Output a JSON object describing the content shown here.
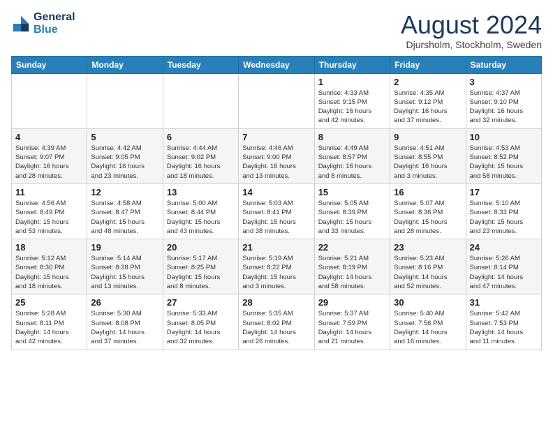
{
  "header": {
    "logo_line1": "General",
    "logo_line2": "Blue",
    "month": "August 2024",
    "location": "Djursholm, Stockholm, Sweden"
  },
  "weekdays": [
    "Sunday",
    "Monday",
    "Tuesday",
    "Wednesday",
    "Thursday",
    "Friday",
    "Saturday"
  ],
  "weeks": [
    [
      {
        "day": "",
        "content": ""
      },
      {
        "day": "",
        "content": ""
      },
      {
        "day": "",
        "content": ""
      },
      {
        "day": "",
        "content": ""
      },
      {
        "day": "1",
        "content": "Sunrise: 4:33 AM\nSunset: 9:15 PM\nDaylight: 16 hours\nand 42 minutes."
      },
      {
        "day": "2",
        "content": "Sunrise: 4:35 AM\nSunset: 9:12 PM\nDaylight: 16 hours\nand 37 minutes."
      },
      {
        "day": "3",
        "content": "Sunrise: 4:37 AM\nSunset: 9:10 PM\nDaylight: 16 hours\nand 32 minutes."
      }
    ],
    [
      {
        "day": "4",
        "content": "Sunrise: 4:39 AM\nSunset: 9:07 PM\nDaylight: 16 hours\nand 28 minutes."
      },
      {
        "day": "5",
        "content": "Sunrise: 4:42 AM\nSunset: 9:05 PM\nDaylight: 16 hours\nand 23 minutes."
      },
      {
        "day": "6",
        "content": "Sunrise: 4:44 AM\nSunset: 9:02 PM\nDaylight: 16 hours\nand 18 minutes."
      },
      {
        "day": "7",
        "content": "Sunrise: 4:46 AM\nSunset: 9:00 PM\nDaylight: 16 hours\nand 13 minutes."
      },
      {
        "day": "8",
        "content": "Sunrise: 4:49 AM\nSunset: 8:57 PM\nDaylight: 16 hours\nand 8 minutes."
      },
      {
        "day": "9",
        "content": "Sunrise: 4:51 AM\nSunset: 8:55 PM\nDaylight: 16 hours\nand 3 minutes."
      },
      {
        "day": "10",
        "content": "Sunrise: 4:53 AM\nSunset: 8:52 PM\nDaylight: 15 hours\nand 58 minutes."
      }
    ],
    [
      {
        "day": "11",
        "content": "Sunrise: 4:56 AM\nSunset: 8:49 PM\nDaylight: 15 hours\nand 53 minutes."
      },
      {
        "day": "12",
        "content": "Sunrise: 4:58 AM\nSunset: 8:47 PM\nDaylight: 15 hours\nand 48 minutes."
      },
      {
        "day": "13",
        "content": "Sunrise: 5:00 AM\nSunset: 8:44 PM\nDaylight: 15 hours\nand 43 minutes."
      },
      {
        "day": "14",
        "content": "Sunrise: 5:03 AM\nSunset: 8:41 PM\nDaylight: 15 hours\nand 38 minutes."
      },
      {
        "day": "15",
        "content": "Sunrise: 5:05 AM\nSunset: 8:39 PM\nDaylight: 15 hours\nand 33 minutes."
      },
      {
        "day": "16",
        "content": "Sunrise: 5:07 AM\nSunset: 8:36 PM\nDaylight: 15 hours\nand 28 minutes."
      },
      {
        "day": "17",
        "content": "Sunrise: 5:10 AM\nSunset: 8:33 PM\nDaylight: 15 hours\nand 23 minutes."
      }
    ],
    [
      {
        "day": "18",
        "content": "Sunrise: 5:12 AM\nSunset: 8:30 PM\nDaylight: 15 hours\nand 18 minutes."
      },
      {
        "day": "19",
        "content": "Sunrise: 5:14 AM\nSunset: 8:28 PM\nDaylight: 15 hours\nand 13 minutes."
      },
      {
        "day": "20",
        "content": "Sunrise: 5:17 AM\nSunset: 8:25 PM\nDaylight: 15 hours\nand 8 minutes."
      },
      {
        "day": "21",
        "content": "Sunrise: 5:19 AM\nSunset: 8:22 PM\nDaylight: 15 hours\nand 3 minutes."
      },
      {
        "day": "22",
        "content": "Sunrise: 5:21 AM\nSunset: 8:19 PM\nDaylight: 14 hours\nand 58 minutes."
      },
      {
        "day": "23",
        "content": "Sunrise: 5:23 AM\nSunset: 8:16 PM\nDaylight: 14 hours\nand 52 minutes."
      },
      {
        "day": "24",
        "content": "Sunrise: 5:26 AM\nSunset: 8:14 PM\nDaylight: 14 hours\nand 47 minutes."
      }
    ],
    [
      {
        "day": "25",
        "content": "Sunrise: 5:28 AM\nSunset: 8:11 PM\nDaylight: 14 hours\nand 42 minutes."
      },
      {
        "day": "26",
        "content": "Sunrise: 5:30 AM\nSunset: 8:08 PM\nDaylight: 14 hours\nand 37 minutes."
      },
      {
        "day": "27",
        "content": "Sunrise: 5:33 AM\nSunset: 8:05 PM\nDaylight: 14 hours\nand 32 minutes."
      },
      {
        "day": "28",
        "content": "Sunrise: 5:35 AM\nSunset: 8:02 PM\nDaylight: 14 hours\nand 26 minutes."
      },
      {
        "day": "29",
        "content": "Sunrise: 5:37 AM\nSunset: 7:59 PM\nDaylight: 14 hours\nand 21 minutes."
      },
      {
        "day": "30",
        "content": "Sunrise: 5:40 AM\nSunset: 7:56 PM\nDaylight: 14 hours\nand 16 minutes."
      },
      {
        "day": "31",
        "content": "Sunrise: 5:42 AM\nSunset: 7:53 PM\nDaylight: 14 hours\nand 11 minutes."
      }
    ]
  ]
}
